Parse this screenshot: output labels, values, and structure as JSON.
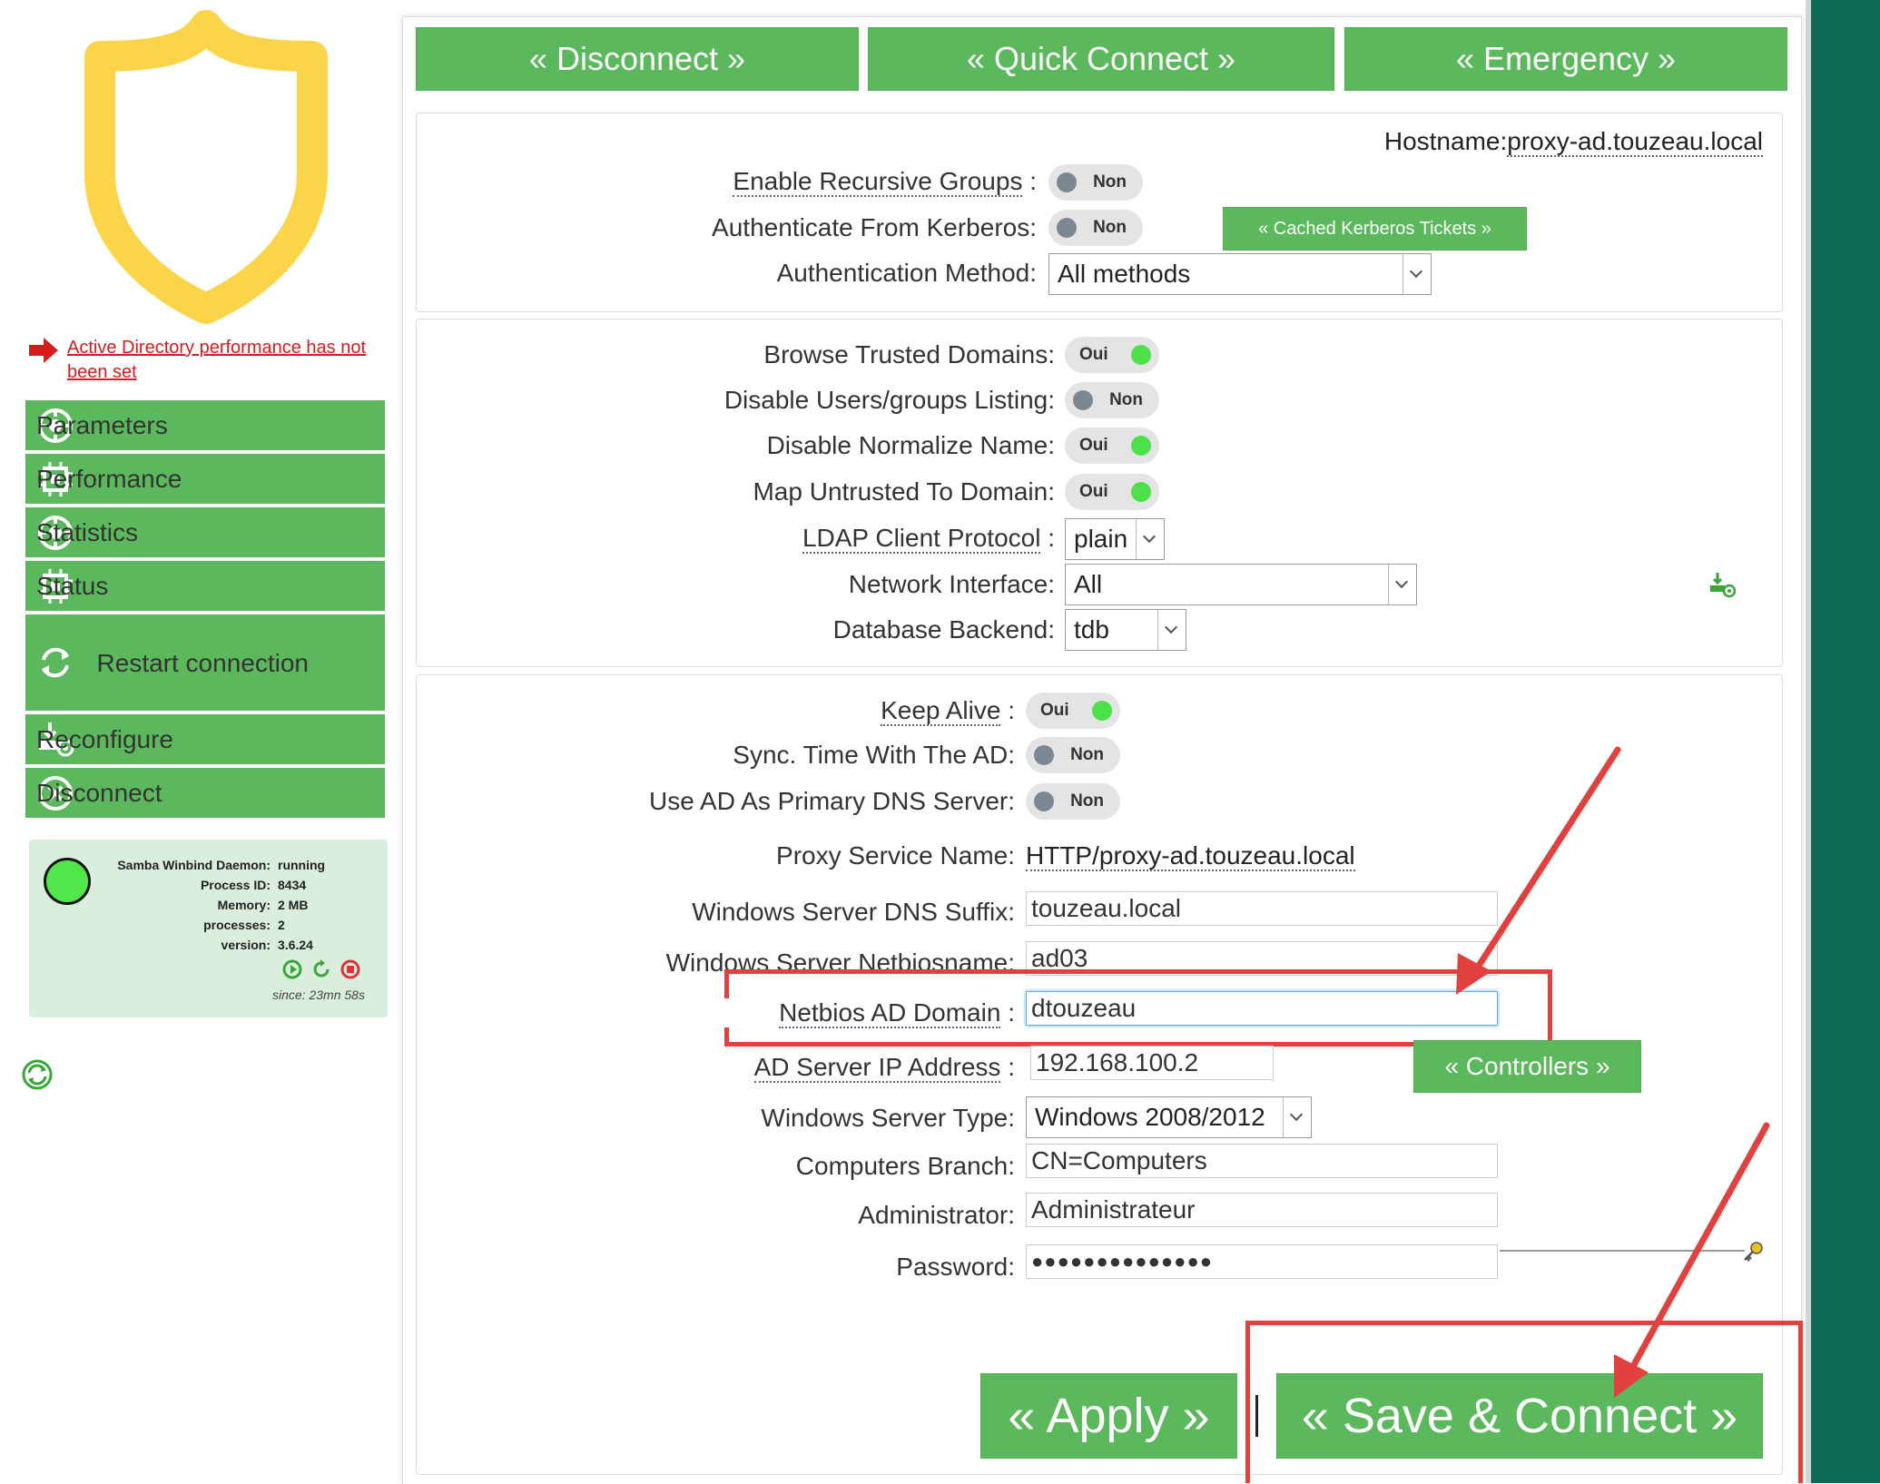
{
  "sidebar": {
    "warning_text": "Active Directory performance has not been set",
    "menu": [
      {
        "label": "Parameters",
        "icon": "gear-icon"
      },
      {
        "label": "Performance",
        "icon": "chip-icon"
      },
      {
        "label": "Statistics",
        "icon": "gear-icon"
      },
      {
        "label": "Status",
        "icon": "chip-icon"
      },
      {
        "label": "Restart connection",
        "icon": "refresh-icon"
      },
      {
        "label": "Reconfigure",
        "icon": "install-icon"
      },
      {
        "label": "Disconnect",
        "icon": "close-circle-icon"
      }
    ],
    "status": {
      "daemon_label": "Samba Winbind Daemon:",
      "daemon_value": "running",
      "pid_label": "Process ID:",
      "pid_value": "8434",
      "memory_label": "Memory:",
      "memory_value": "2 MB",
      "processes_label": "processes:",
      "processes_value": "2",
      "version_label": "version:",
      "version_value": "3.6.24",
      "since": "since: 23mn 58s",
      "led_color": "#52e64a"
    }
  },
  "top_buttons": {
    "disconnect": "« Disconnect »",
    "quick_connect": "« Quick Connect »",
    "emergency": "« Emergency »"
  },
  "section1": {
    "hostname_label": "Hostname:",
    "hostname_value": "proxy-ad.touzeau.local",
    "recursive_groups_label": "Enable Recursive Groups",
    "recursive_groups_value": "Non",
    "auth_kerberos_label": "Authenticate From Kerberos:",
    "auth_kerberos_value": "Non",
    "cached_tickets_button": "« Cached Kerberos Tickets »",
    "auth_method_label": "Authentication Method:",
    "auth_method_value": "All methods"
  },
  "section2": {
    "browse_trusted_label": "Browse Trusted Domains:",
    "browse_trusted_value": "Oui",
    "disable_listing_label": "Disable Users/groups Listing:",
    "disable_listing_value": "Non",
    "disable_normalize_label": "Disable Normalize Name:",
    "disable_normalize_value": "Oui",
    "map_untrusted_label": "Map Untrusted To Domain:",
    "map_untrusted_value": "Oui",
    "ldap_protocol_label": "LDAP Client Protocol",
    "ldap_protocol_value": "plain",
    "network_interface_label": "Network Interface:",
    "network_interface_value": "All",
    "db_backend_label": "Database Backend:",
    "db_backend_value": "tdb"
  },
  "section3": {
    "keep_alive_label": "Keep Alive",
    "keep_alive_value": "Oui",
    "sync_time_label": "Sync. Time With The AD:",
    "sync_time_value": "Non",
    "primary_dns_label": "Use AD As Primary DNS Server:",
    "primary_dns_value": "Non",
    "proxy_service_label": "Proxy Service Name:",
    "proxy_service_value": "HTTP/proxy-ad.touzeau.local",
    "dns_suffix_label": "Windows Server DNS Suffix:",
    "dns_suffix_value": "touzeau.local",
    "netbiosname_label": "Windows Server Netbiosname:",
    "netbiosname_value": "ad03",
    "netbios_domain_label": "Netbios AD Domain",
    "netbios_domain_value": "dtouzeau",
    "ad_ip_label": "AD Server IP Address",
    "ad_ip_value": "192.168.100.2",
    "controllers_button": "« Controllers »",
    "server_type_label": "Windows Server Type:",
    "server_type_value": "Windows 2008/2012",
    "computers_branch_label": "Computers Branch:",
    "computers_branch_value": "CN=Computers",
    "admin_label": "Administrator:",
    "admin_value": "Administrateur",
    "password_label": "Password:",
    "password_value": "●●●●●●●●●●●●●●",
    "apply_button": "« Apply »",
    "save_connect_button": "« Save & Connect »"
  },
  "colors": {
    "green": "#5cb85c",
    "annotation_red": "#e0403e",
    "shield_yellow": "#fcd44a",
    "warning_red": "#d51d1d"
  }
}
